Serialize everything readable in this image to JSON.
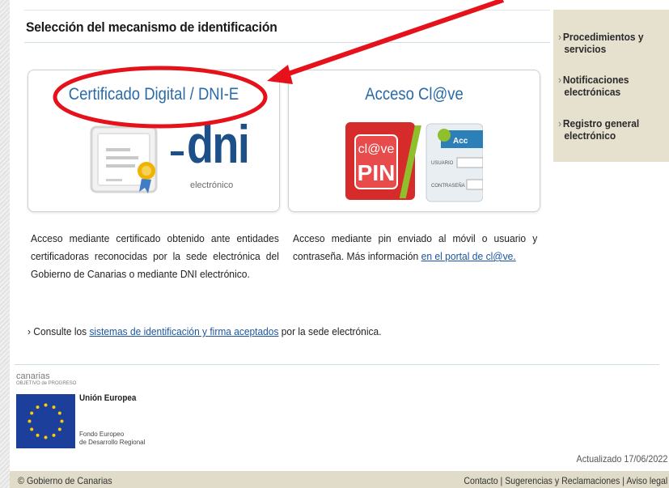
{
  "section_title": "Selección del mecanismo de identificación",
  "cards": {
    "cert": {
      "title": "Certificado Digital / DNI-E",
      "dni_word": "dni",
      "dni_sub": "electrónico",
      "description": "Acceso mediante certificado obtenido ante entidades certificadoras reconocidas por la sede electrónica del Gobierno de Canarias o mediante DNI electrónico."
    },
    "clave": {
      "title": "Acceso Cl@ve",
      "pin_top": "cl@ve",
      "pin_bottom": "PIN",
      "form_header": "Acc",
      "usuario": "USUARIO",
      "contrasena": "CONTRASEÑA",
      "description_prefix": "Acceso mediante pin enviado al móvil o usuario y contraseña. Más información ",
      "description_link": "en el portal de cl@ve."
    }
  },
  "consult": {
    "prefix": "› Consulte los ",
    "link": "sistemas de identificación y firma aceptados",
    "suffix": " por la sede electrónica."
  },
  "footer": {
    "canarias": "canarias",
    "canarias_sub": "OBJETIVO de PROGRESO",
    "eu_title": "Unión Europea",
    "eu_sub_1": "Fondo Europeo",
    "eu_sub_2": "de Desarrollo Regional",
    "updated": "Actualizado 17/06/2022",
    "copyright": "© Gobierno de Canarias",
    "links": [
      "Contacto",
      "Sugerencias y Reclamaciones",
      "Aviso legal"
    ]
  },
  "sidebar": {
    "items": [
      {
        "line1": "Procedimientos y",
        "line2": "servicios"
      },
      {
        "line1": "Notificaciones",
        "line2": "electrónicas"
      },
      {
        "line1": "Registro general",
        "line2": "electrónico"
      }
    ]
  },
  "colors": {
    "accent_blue": "#2a6aa6",
    "link_blue": "#1c56a0",
    "annotation_red": "#e5121b",
    "sidebar_bg": "#e6e0ce",
    "footer_bar": "#e1dcc9",
    "eu_blue": "#1b3f9a",
    "eu_star": "#ffcc00"
  },
  "icons": {
    "certificate": "certificate-icon",
    "pin": "clave-pin-icon",
    "eu_flag": "eu-flag-icon",
    "chevron": "chevron-right-icon"
  }
}
